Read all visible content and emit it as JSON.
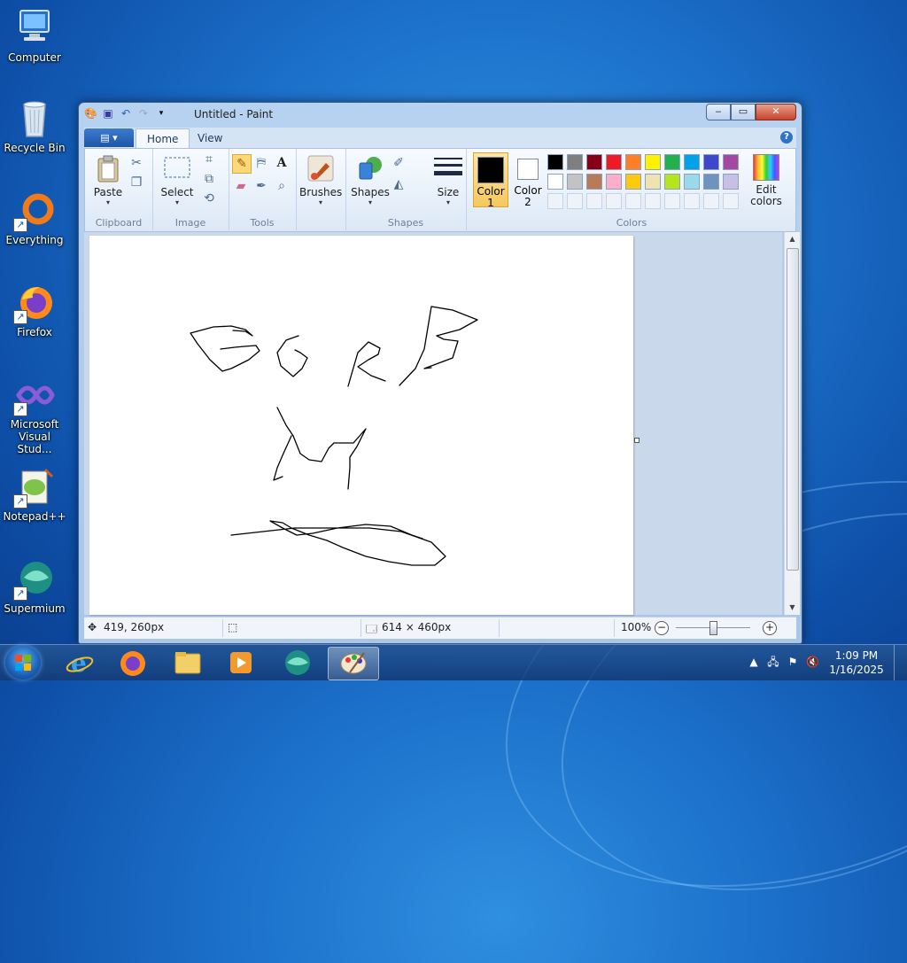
{
  "desktop": {
    "icons": [
      {
        "label": "Computer"
      },
      {
        "label": "Recycle Bin"
      },
      {
        "label": "Everything"
      },
      {
        "label": "Firefox"
      },
      {
        "label": "Microsoft Visual Stud..."
      },
      {
        "label": "Notepad++"
      },
      {
        "label": "Supermium"
      }
    ]
  },
  "window": {
    "title": "Untitled - Paint",
    "controls": {
      "minimize": "‒",
      "maximize": "▭",
      "close": "✕"
    }
  },
  "ribbon": {
    "app_menu": "▤ ▾",
    "tabs": [
      {
        "label": "Home"
      },
      {
        "label": "View"
      }
    ],
    "help": "?",
    "groups": {
      "clipboard": {
        "label": "Clipboard",
        "paste": "Paste"
      },
      "image": {
        "label": "Image",
        "select": "Select"
      },
      "tools": {
        "label": "Tools"
      },
      "brushes": {
        "label": "Brushes"
      },
      "shapes": {
        "label": "Shapes",
        "shapes_button": "Shapes"
      },
      "size": {
        "label": "Size"
      },
      "colors": {
        "label": "Colors",
        "color1_label": "Color",
        "color1_num": "1",
        "color2_label": "Color",
        "color2_num": "2",
        "edit_label": "Edit",
        "edit_label2": "colors",
        "color1": "#000000",
        "color2": "#ffffff",
        "palette_row1": [
          "#000000",
          "#7f7f7f",
          "#880015",
          "#ed1c24",
          "#ff7f27",
          "#fff200",
          "#22b14c",
          "#00a2e8",
          "#3f48cc",
          "#a349a4"
        ],
        "palette_row2": [
          "#ffffff",
          "#c3c3c3",
          "#b97a57",
          "#ffaec9",
          "#ffc90e",
          "#efe4b0",
          "#b5e61d",
          "#99d9ea",
          "#7092be",
          "#c8bfe7"
        ]
      }
    }
  },
  "statusbar": {
    "cursor_pos": "419, 260px",
    "canvas_size": "614 × 460px",
    "zoom": "100%"
  },
  "taskbar": {
    "clock_time": "1:09 PM",
    "clock_date": "1/16/2025"
  }
}
